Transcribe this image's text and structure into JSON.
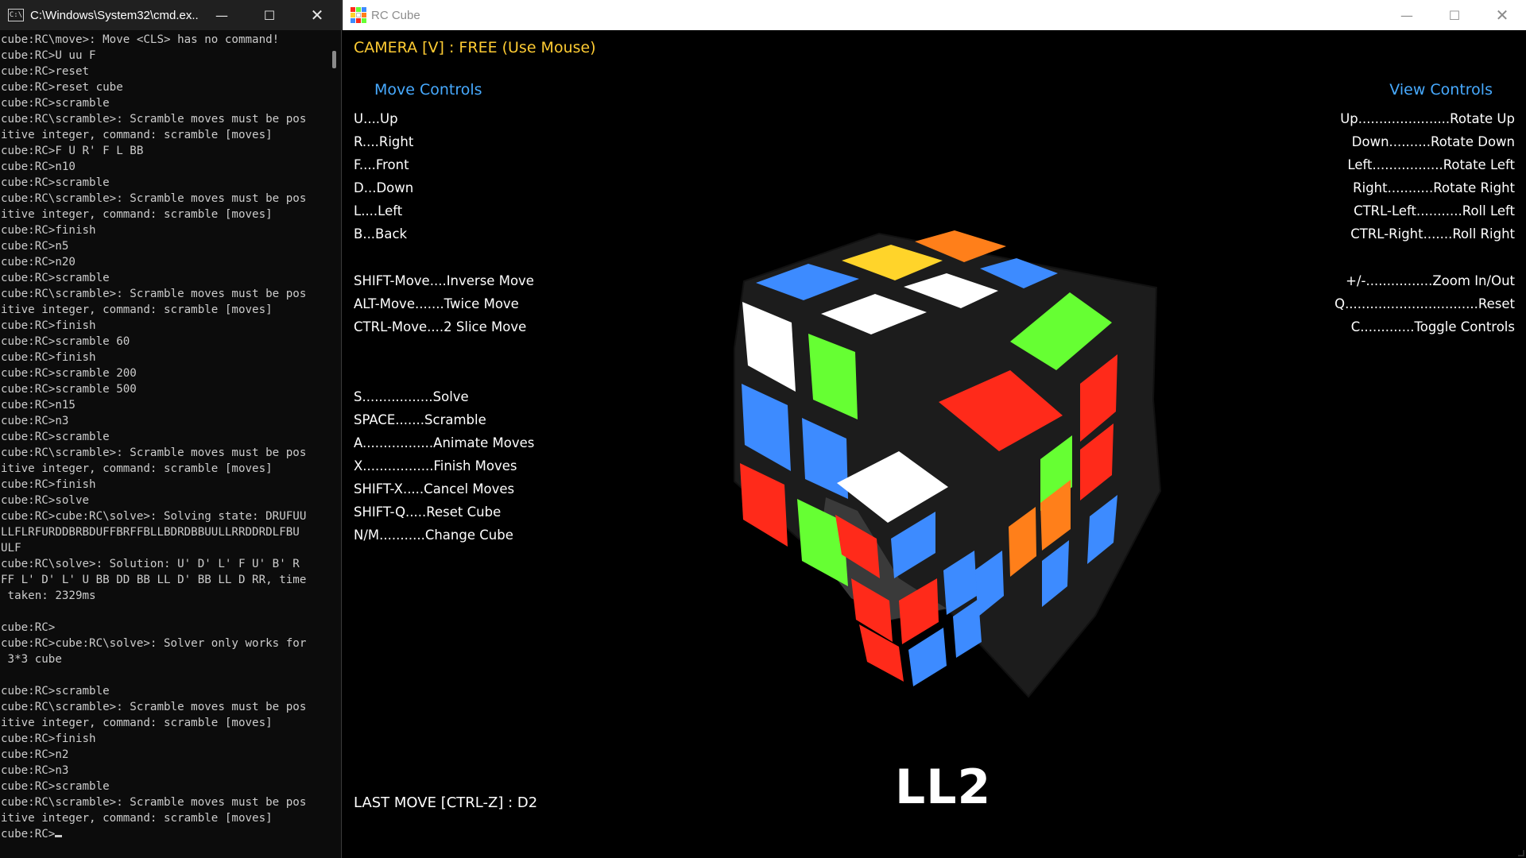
{
  "cmd": {
    "title": "C:\\Windows\\System32\\cmd.ex...",
    "icon": "cmd-icon",
    "lines": [
      "cube:RC\\move>: Move <CLS> has no command!",
      "cube:RC>U uu F",
      "cube:RC>reset",
      "cube:RC>reset cube",
      "cube:RC>scramble",
      "cube:RC\\scramble>: Scramble moves must be pos",
      "itive integer, command: scramble [moves]",
      "cube:RC>F U R' F L BB",
      "cube:RC>n10",
      "cube:RC>scramble",
      "cube:RC\\scramble>: Scramble moves must be pos",
      "itive integer, command: scramble [moves]",
      "cube:RC>finish",
      "cube:RC>n5",
      "cube:RC>n20",
      "cube:RC>scramble",
      "cube:RC\\scramble>: Scramble moves must be pos",
      "itive integer, command: scramble [moves]",
      "cube:RC>finish",
      "cube:RC>scramble 60",
      "cube:RC>finish",
      "cube:RC>scramble 200",
      "cube:RC>scramble 500",
      "cube:RC>n15",
      "cube:RC>n3",
      "cube:RC>scramble",
      "cube:RC\\scramble>: Scramble moves must be pos",
      "itive integer, command: scramble [moves]",
      "cube:RC>finish",
      "cube:RC>solve",
      "cube:RC>cube:RC\\solve>: Solving state: DRUFUU",
      "LLFLRFURDDBRBDUFFBRFFBLLBDRDBBUULLRRDDRDLFBU",
      "ULF",
      "cube:RC\\solve>: Solution: U' D' L' F U' B' R",
      "FF L' D' L' U BB DD BB LL D' BB LL D RR, time",
      " taken: 2329ms",
      "",
      "cube:RC>",
      "cube:RC>cube:RC\\solve>: Solver only works for",
      " 3*3 cube",
      "",
      "cube:RC>scramble",
      "cube:RC\\scramble>: Scramble moves must be pos",
      "itive integer, command: scramble [moves]",
      "cube:RC>finish",
      "cube:RC>n2",
      "cube:RC>n3",
      "cube:RC>scramble",
      "cube:RC\\scramble>: Scramble moves must be pos",
      "itive integer, command: scramble [moves]"
    ],
    "prompt": "cube:RC>"
  },
  "rc": {
    "title": "RC Cube",
    "icon": "rubiks-cube-icon",
    "camera": "CAMERA [V] : FREE (Use Mouse)",
    "move_controls": {
      "heading": "Move Controls",
      "items": [
        "U....Up",
        "R....Right",
        "F....Front",
        "D...Down",
        "L....Left",
        "B...Back",
        "SHIFT-Move....Inverse Move",
        "ALT-Move.......Twice Move",
        "CTRL-Move....2 Slice Move",
        "S.................Solve",
        "SPACE.......Scramble",
        "A.................Animate Moves",
        "X.................Finish Moves",
        "SHIFT-X.....Cancel Moves",
        "SHIFT-Q.....Reset Cube",
        "N/M...........Change Cube"
      ]
    },
    "view_controls": {
      "heading": "View Controls",
      "items": [
        "Up......................Rotate Up",
        "Down..........Rotate Down",
        "Left.................Rotate Left",
        "Right...........Rotate Right",
        "CTRL-Left...........Roll Left",
        "CTRL-Right.......Roll Right",
        "+/-................Zoom In/Out",
        "Q................................Reset",
        "C.............Toggle Controls"
      ]
    },
    "last_move": "LAST MOVE [CTRL-Z] : D2",
    "current_move": "LL2",
    "colors": {
      "white": "#ffffff",
      "yellow": "#ffd42a",
      "orange": "#ff7f1a",
      "blue": "#3d8bff",
      "green": "#66ff33",
      "red": "#ff2a1a",
      "body": "#1c1c1c",
      "accent_yellow": "#ffcc33",
      "accent_blue": "#47aaff"
    }
  }
}
